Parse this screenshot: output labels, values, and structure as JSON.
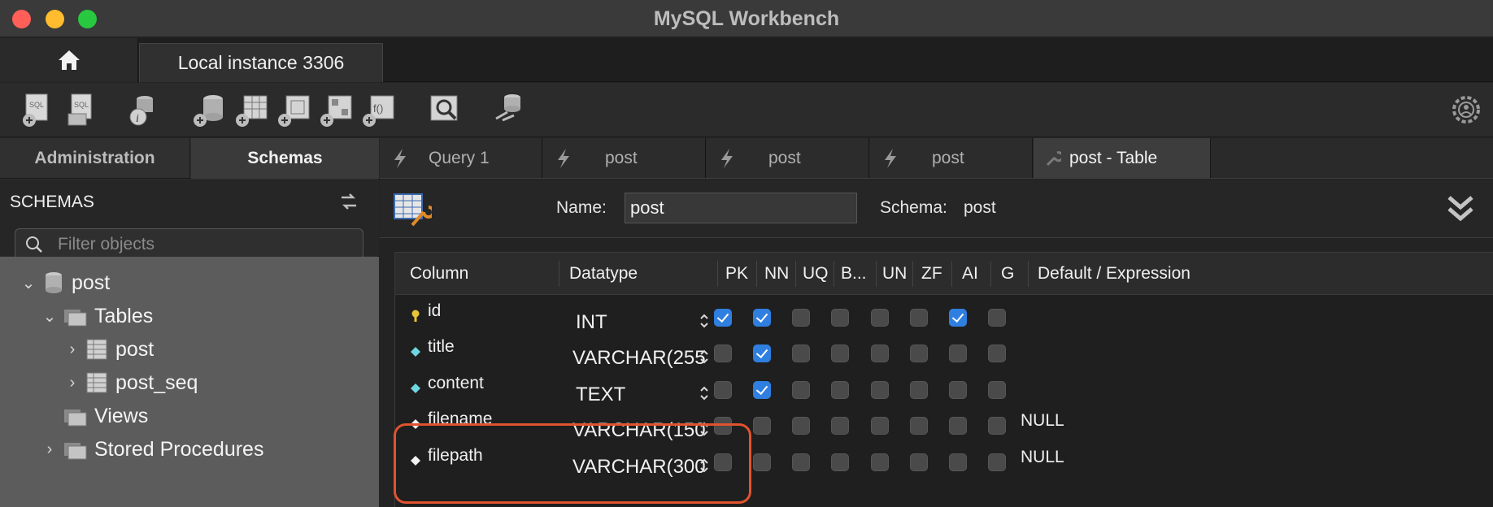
{
  "window": {
    "title": "MySQL Workbench"
  },
  "connection_tabs": [
    {
      "label": "Local instance 3306"
    }
  ],
  "toolbar": {
    "icons": [
      "new-sql-icon",
      "open-sql-icon",
      "schema-inspector-icon",
      "create-schema-icon",
      "create-table-icon",
      "create-view-icon",
      "create-procedure-icon",
      "create-function-icon",
      "search-table-data-icon",
      "reconnect-icon",
      "settings-icon"
    ]
  },
  "sidebar": {
    "tabs": [
      {
        "label": "Administration"
      },
      {
        "label": "Schemas"
      }
    ],
    "header": "SCHEMAS",
    "filter_placeholder": "Filter objects",
    "tree": {
      "schema": "post",
      "tables_label": "Tables",
      "tables": [
        "post",
        "post_seq"
      ],
      "views_label": "Views",
      "procedures_label": "Stored Procedures"
    }
  },
  "query_tabs": [
    {
      "label": "Query 1"
    },
    {
      "label": "post"
    },
    {
      "label": "post"
    },
    {
      "label": "post"
    },
    {
      "label": "post - Table"
    }
  ],
  "editor": {
    "name_label": "Name:",
    "name_value": "post",
    "schema_label": "Schema:",
    "schema_value": "post"
  },
  "grid": {
    "headers": [
      "Column",
      "Datatype",
      "PK",
      "NN",
      "UQ",
      "B...",
      "UN",
      "ZF",
      "AI",
      "G",
      "Default / Expression"
    ],
    "rows": [
      {
        "name": "id",
        "type": "INT",
        "icon": "primary-key-icon",
        "flags": [
          true,
          true,
          false,
          false,
          false,
          false,
          true,
          false
        ],
        "default": ""
      },
      {
        "name": "title",
        "type": "VARCHAR(255",
        "icon": "column-diamond-icon",
        "flags": [
          false,
          true,
          false,
          false,
          false,
          false,
          false,
          false
        ],
        "default": ""
      },
      {
        "name": "content",
        "type": "TEXT",
        "icon": "column-diamond-icon",
        "flags": [
          false,
          true,
          false,
          false,
          false,
          false,
          false,
          false
        ],
        "default": ""
      },
      {
        "name": "filename",
        "type": "VARCHAR(150",
        "icon": "nullable-diamond-icon",
        "flags": [
          false,
          false,
          false,
          false,
          false,
          false,
          false,
          false
        ],
        "default": "NULL"
      },
      {
        "name": "filepath",
        "type": "VARCHAR(300",
        "icon": "nullable-diamond-icon",
        "flags": [
          false,
          false,
          false,
          false,
          false,
          false,
          false,
          false
        ],
        "default": "NULL"
      }
    ]
  },
  "colors": {
    "accent": "#2f7fe0",
    "highlight": "#e0532f"
  }
}
